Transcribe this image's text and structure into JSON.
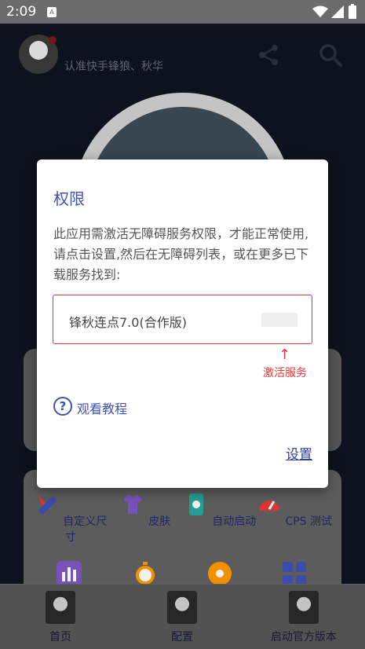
{
  "status_bar": {
    "time": "2:09",
    "sim_label": "A"
  },
  "header": {
    "title": "",
    "subtitle": "认准快手锋狼、秋华"
  },
  "grid": {
    "items": [
      {
        "label": "自定义尺寸",
        "icon": "ruler-pencil-icon",
        "color": "#3f51b5"
      },
      {
        "label": "皮肤",
        "icon": "tshirt-icon",
        "color": "#7e57c2"
      },
      {
        "label": "自动启动",
        "icon": "phone-sync-icon",
        "color": "#26a69a"
      },
      {
        "label": "CPS 测试",
        "icon": "speedometer-icon",
        "color": "#e53935"
      }
    ]
  },
  "bottom_nav": {
    "items": [
      {
        "label": "首页"
      },
      {
        "label": "配置"
      },
      {
        "label": "启动官方版本"
      }
    ]
  },
  "dialog": {
    "title": "权限",
    "message": "此应用需激活无障碍服务权限，才能正常使用,请点击设置,然后在无障碍列表，或在更多已下载服务找到:",
    "service_name": "锋秋连点7.0(合作版)",
    "arrow": "↑",
    "activate_label": "激活服务",
    "help_label": "观看教程",
    "help_icon_glyph": "?",
    "settings_label": "设置"
  },
  "colors": {
    "accent": "#3f51b5",
    "highlight": "#e53935"
  }
}
